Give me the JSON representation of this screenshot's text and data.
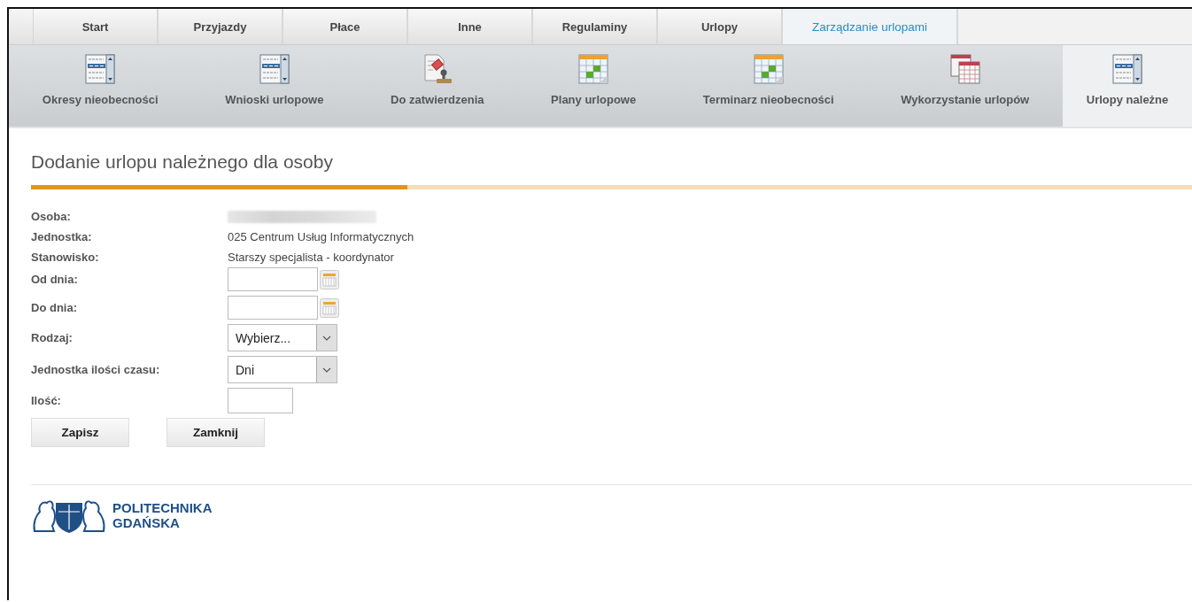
{
  "tabs": [
    {
      "label": "Start",
      "selected": false
    },
    {
      "label": "Przyjazdy",
      "selected": false
    },
    {
      "label": "Płace",
      "selected": false
    },
    {
      "label": "Inne",
      "selected": false
    },
    {
      "label": "Regulaminy",
      "selected": false
    },
    {
      "label": "Urlopy",
      "selected": false
    },
    {
      "label": "Zarządzanie urlopami",
      "selected": true
    }
  ],
  "subnav": [
    {
      "label": "Okresy nieobecności",
      "kind": "list",
      "selected": false
    },
    {
      "label": "Wnioski urlopowe",
      "kind": "list",
      "selected": false
    },
    {
      "label": "Do zatwierdzenia",
      "kind": "stamp",
      "selected": false
    },
    {
      "label": "Plany urlopowe",
      "kind": "calendar",
      "selected": false
    },
    {
      "label": "Terminarz nieobecności",
      "kind": "calendar",
      "selected": false
    },
    {
      "label": "Wykorzystanie urlopów",
      "kind": "tables",
      "selected": false
    },
    {
      "label": "Urlopy należne",
      "kind": "list",
      "selected": true
    }
  ],
  "title": "Dodanie urlopu należnego dla osoby",
  "form": [
    {
      "label": "Osoba:",
      "kind": "redacted"
    },
    {
      "label": "Jednostka:",
      "kind": "text",
      "value": "025 Centrum Usług Informatycznych"
    },
    {
      "label": "Stanowisko:",
      "kind": "text",
      "value": "Starszy specjalista - koordynator"
    },
    {
      "label": "Od dnia:",
      "kind": "date"
    },
    {
      "label": "Do dnia:",
      "kind": "date"
    },
    {
      "label": "Rodzaj:",
      "kind": "select",
      "value": "Wybierz..."
    },
    {
      "label": "Jednostka ilości czasu:",
      "kind": "select",
      "value": "Dni"
    },
    {
      "label": "Ilość:",
      "kind": "input"
    }
  ],
  "buttons": [
    "Zapisz",
    "Zamknij"
  ],
  "footer": {
    "logo_lines": [
      "POLITECHNIKA",
      "GDAŃSKA"
    ]
  }
}
